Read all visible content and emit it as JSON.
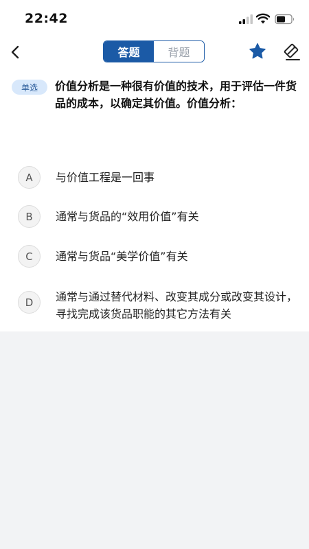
{
  "status_bar": {
    "time": "22:42",
    "icons": [
      "signal-icon",
      "wifi-icon",
      "battery-icon"
    ]
  },
  "nav": {
    "back_icon": "chevron-left-icon",
    "tabs": [
      {
        "label": "答题",
        "active": true
      },
      {
        "label": "背题",
        "active": false
      }
    ],
    "favorite_icon": "star-icon",
    "clear_icon": "eraser-icon"
  },
  "question": {
    "type_badge": "单选",
    "text": "价值分析是一种很有价值的技术，用于评估一件货品的成本，以确定其价值。价值分析："
  },
  "options": [
    {
      "letter": "A",
      "text": "与价值工程是一回事"
    },
    {
      "letter": "B",
      "text": "通常与货品的“效用价值”有关"
    },
    {
      "letter": "C",
      "text": "通常与货品“美学价值”有关"
    },
    {
      "letter": "D",
      "text": "通常与通过替代材料、改变其成分或改变其设计，寻找完成该货品职能的其它方法有关"
    }
  ],
  "colors": {
    "accent": "#1b5aa6",
    "badge_bg": "#d8e8fb",
    "page_bg": "#f2f3f5"
  }
}
